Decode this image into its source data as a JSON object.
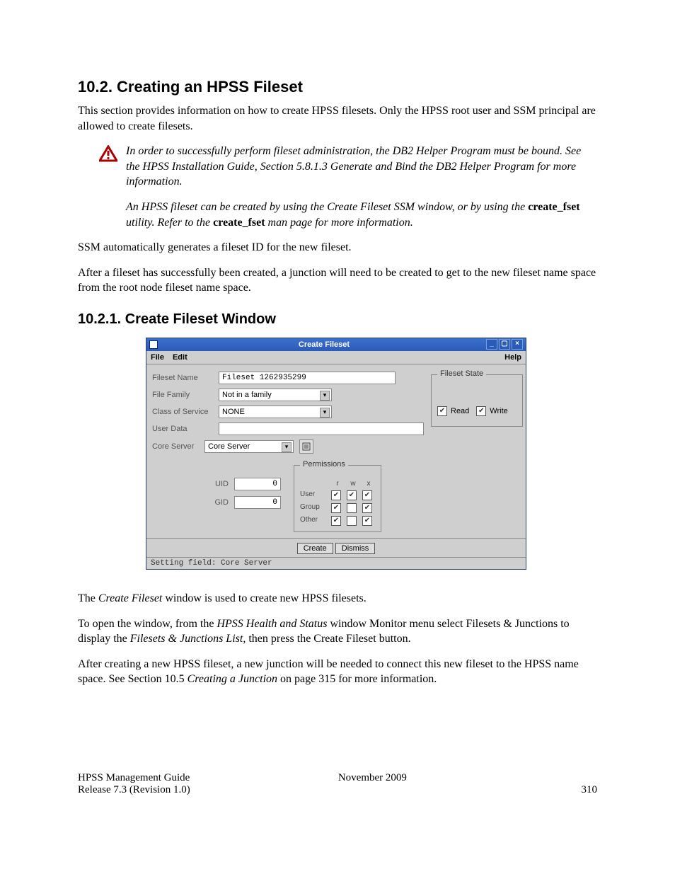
{
  "doc": {
    "section_title": "10.2.  Creating an HPSS Fileset",
    "section_intro": "This section provides information on how to create HPSS filesets.  Only the HPSS root user and SSM principal are allowed to create filesets.",
    "note1": "In order to successfully perform fileset administration, the DB2 Helper Program must be bound. See the HPSS Installation Guide, Section 5.8.1.3 Generate and Bind the DB2 Helper Program for more information.",
    "note2_pre": "An HPSS fileset can be created by using the Create Fileset SSM window, or by using the ",
    "note2_util1": "create_fset",
    "note2_mid": " utility.  Refer to the ",
    "note2_util2": "create_fset",
    "note2_post": " man page for more information.",
    "para_ssm": "SSM automatically generates a fileset ID for the new fileset.",
    "para_junction": "After a fileset has successfully been created, a junction will need to be created to get to the new fileset name space from the root node fileset name space.",
    "subsection_title": "10.2.1.  Create Fileset Window",
    "post_fig_p1_pre": "The ",
    "post_fig_p1_em": "Create Fileset",
    "post_fig_p1_post": " window is used to create new HPSS filesets.",
    "post_fig_p2_pre": "To open the window, from the ",
    "post_fig_p2_em1": "HPSS Health and Status",
    "post_fig_p2_mid": " window Monitor menu select Filesets & Junctions to display the ",
    "post_fig_p2_em2": "Filesets & Junctions List,",
    "post_fig_p2_post": " then press the Create Fileset button.",
    "post_fig_p3_pre": "After creating a new HPSS fileset, a new junction will be needed to connect this new fileset to the HPSS name space. See Section 10.5 ",
    "post_fig_p3_em": "Creating a Junction",
    "post_fig_p3_post": " on page 315 for more information."
  },
  "gui": {
    "title": "Create Fileset",
    "menu": {
      "file": "File",
      "edit": "Edit",
      "help": "Help"
    },
    "labels": {
      "fileset_name": "Fileset Name",
      "file_family": "File Family",
      "class_of_service": "Class of Service",
      "user_data": "User Data",
      "core_server": "Core Server",
      "uid": "UID",
      "gid": "GID",
      "permissions": "Permissions",
      "fileset_state": "Fileset State",
      "read": "Read",
      "write": "Write",
      "r": "r",
      "w": "w",
      "x": "x",
      "user": "User",
      "group": "Group",
      "other": "Other"
    },
    "values": {
      "fileset_name": "Fileset 1262935299",
      "file_family": "Not in a family",
      "class_of_service": "NONE",
      "user_data": "",
      "core_server": "Core Server",
      "uid": "0",
      "gid": "0"
    },
    "state": {
      "read": true,
      "write": true
    },
    "perms": {
      "user": {
        "r": true,
        "w": true,
        "x": true
      },
      "group": {
        "r": true,
        "w": false,
        "x": true
      },
      "other": {
        "r": true,
        "w": false,
        "x": true
      }
    },
    "buttons": {
      "create": "Create",
      "dismiss": "Dismiss"
    },
    "status": "Setting field: Core Server"
  },
  "footer": {
    "guide": "HPSS Management Guide",
    "release": "Release 7.3 (Revision 1.0)",
    "date": "November 2009",
    "page": "310"
  }
}
